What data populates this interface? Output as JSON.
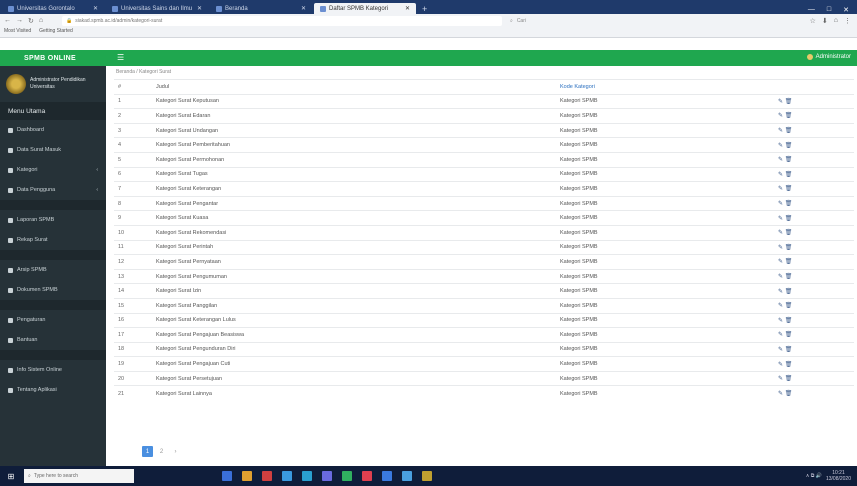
{
  "browser": {
    "tabs": [
      {
        "label": "Universitas Gorontalo",
        "active": false
      },
      {
        "label": "Universitas Sains dan Ilmu",
        "active": false
      },
      {
        "label": "Beranda",
        "active": false
      },
      {
        "label": "Daftar SPMB Kategori",
        "active": true
      }
    ],
    "new_tab": "+",
    "window_controls": [
      "—",
      "□",
      "✕"
    ],
    "url": "siakad.spmb.ac.id/admin/kategori-surat",
    "search_placeholder": "Cari",
    "bookmarks": [
      "Most Visited",
      "Getting Started"
    ],
    "nav": [
      "←",
      "→",
      "↻",
      "⌂"
    ],
    "tools": [
      "☆",
      "⬇",
      "⌂",
      "⋮"
    ]
  },
  "app": {
    "brand": "SPMB ONLINE",
    "menu_icon": "☰",
    "user": "Administrator"
  },
  "sidebar": {
    "profile_name": "Administrator Pendidikan",
    "profile_sub": "Universitas",
    "menu_title": "Menu Utama",
    "groups": [
      {
        "items": [
          {
            "label": "Dashboard",
            "icon": "home-icon",
            "chevron": ""
          },
          {
            "label": "Data Surat Masuk",
            "icon": "inbox-icon",
            "chevron": ""
          },
          {
            "label": "Kategori",
            "icon": "tag-icon",
            "chevron": "‹"
          },
          {
            "label": "Data Pengguna",
            "icon": "users-icon",
            "chevron": "‹"
          }
        ]
      },
      {
        "items": [
          {
            "label": "Laporan SPMB",
            "icon": "report-icon",
            "chevron": ""
          },
          {
            "label": "Rekap Surat",
            "icon": "file-icon",
            "chevron": ""
          }
        ]
      },
      {
        "items": [
          {
            "label": "Arsip SPMB",
            "icon": "archive-icon",
            "chevron": ""
          },
          {
            "label": "Dokumen SPMB",
            "icon": "document-icon",
            "chevron": ""
          }
        ]
      },
      {
        "items": [
          {
            "label": "Pengaturan",
            "icon": "gear-icon",
            "chevron": ""
          },
          {
            "label": "Bantuan",
            "icon": "help-icon",
            "chevron": ""
          }
        ]
      },
      {
        "items": [
          {
            "label": "Info Sistem Online",
            "icon": "info-icon",
            "chevron": ""
          },
          {
            "label": "Tentang Aplikasi",
            "icon": "about-icon",
            "chevron": ""
          }
        ]
      }
    ]
  },
  "content": {
    "breadcrumb": "Beranda / Kategori Surat",
    "table": {
      "headers": [
        "#",
        "Judul",
        "Kode Kategori",
        ""
      ],
      "rows": [
        {
          "no": "1",
          "name": "Kategori Surat Keputusan",
          "cat": "Kategori SPMB",
          "act": "✎ 🗑"
        },
        {
          "no": "2",
          "name": "Kategori Surat Edaran",
          "cat": "Kategori SPMB",
          "act": "✎ 🗑"
        },
        {
          "no": "3",
          "name": "Kategori Surat Undangan",
          "cat": "Kategori SPMB",
          "act": "✎ 🗑"
        },
        {
          "no": "4",
          "name": "Kategori Surat Pemberitahuan",
          "cat": "Kategori SPMB",
          "act": "✎ 🗑"
        },
        {
          "no": "5",
          "name": "Kategori Surat Permohonan",
          "cat": "Kategori SPMB",
          "act": "✎ 🗑"
        },
        {
          "no": "6",
          "name": "Kategori Surat Tugas",
          "cat": "Kategori SPMB",
          "act": "✎ 🗑"
        },
        {
          "no": "7",
          "name": "Kategori Surat Keterangan",
          "cat": "Kategori SPMB",
          "act": "✎ 🗑"
        },
        {
          "no": "8",
          "name": "Kategori Surat Pengantar",
          "cat": "Kategori SPMB",
          "act": "✎ 🗑"
        },
        {
          "no": "9",
          "name": "Kategori Surat Kuasa",
          "cat": "Kategori SPMB",
          "act": "✎ 🗑"
        },
        {
          "no": "10",
          "name": "Kategori Surat Rekomendasi",
          "cat": "Kategori SPMB",
          "act": "✎ 🗑"
        },
        {
          "no": "11",
          "name": "Kategori Surat Perintah",
          "cat": "Kategori SPMB",
          "act": "✎ 🗑"
        },
        {
          "no": "12",
          "name": "Kategori Surat Pernyataan",
          "cat": "Kategori SPMB",
          "act": "✎ 🗑"
        },
        {
          "no": "13",
          "name": "Kategori Surat Pengumuman",
          "cat": "Kategori SPMB",
          "act": "✎ 🗑"
        },
        {
          "no": "14",
          "name": "Kategori Surat Izin",
          "cat": "Kategori SPMB",
          "act": "✎ 🗑"
        },
        {
          "no": "15",
          "name": "Kategori Surat Panggilan",
          "cat": "Kategori SPMB",
          "act": "✎ 🗑"
        },
        {
          "no": "16",
          "name": "Kategori Surat Keterangan Lulus",
          "cat": "Kategori SPMB",
          "act": "✎ 🗑"
        },
        {
          "no": "17",
          "name": "Kategori Surat Pengajuan Beasiswa",
          "cat": "Kategori SPMB",
          "act": "✎ 🗑"
        },
        {
          "no": "18",
          "name": "Kategori Surat Pengunduran Diri",
          "cat": "Kategori SPMB",
          "act": "✎ 🗑"
        },
        {
          "no": "19",
          "name": "Kategori Surat Pengajuan Cuti",
          "cat": "Kategori SPMB",
          "act": "✎ 🗑"
        },
        {
          "no": "20",
          "name": "Kategori Surat Persetujuan",
          "cat": "Kategori SPMB",
          "act": "✎ 🗑"
        },
        {
          "no": "21",
          "name": "Kategori Surat Lainnya",
          "cat": "Kategori SPMB",
          "act": "✎ 🗑"
        }
      ]
    },
    "pager": [
      "1",
      "2",
      "›"
    ]
  },
  "taskbar": {
    "start": "⊞",
    "search_placeholder": "Type here to search",
    "apps": [
      "#3a6fd8",
      "#e0a030",
      "#d04040",
      "#3a9ae0",
      "#2aa0d0",
      "#6a6ae0",
      "#30b060",
      "#e04050",
      "#3a7ae0",
      "#4aa0e0",
      "#c0a030"
    ],
    "tray": "∧ ⧉ 🔊",
    "time": "10:21",
    "date": "13/08/2020"
  }
}
